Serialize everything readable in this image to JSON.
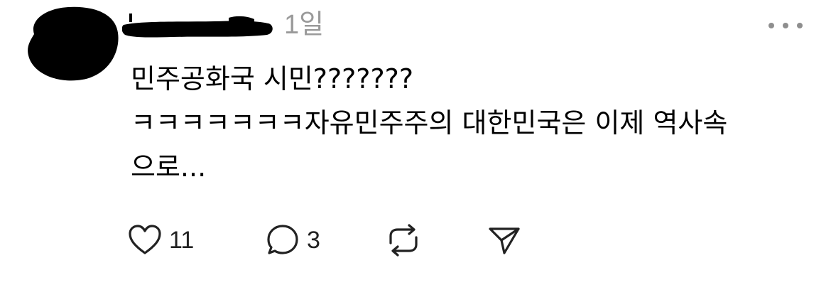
{
  "post": {
    "author": {
      "avatar_icon": "avatar-redacted",
      "username_icon": "username-redacted"
    },
    "timestamp": "1일",
    "more_icon": "more-horizontal-icon",
    "text_lines": [
      "민주공화국 시민???????",
      "ㅋㅋㅋㅋㅋㅋㅋ자유민주주의 대한민국은 이제 역사속",
      "으로..."
    ],
    "actions": {
      "like": {
        "icon": "heart-icon",
        "count": "11"
      },
      "reply": {
        "icon": "comment-icon",
        "count": "3"
      },
      "repost": {
        "icon": "repost-icon"
      },
      "share": {
        "icon": "send-icon"
      }
    }
  },
  "colors": {
    "text": "#000000",
    "muted": "#9a9a9a",
    "icon": "#222222"
  }
}
